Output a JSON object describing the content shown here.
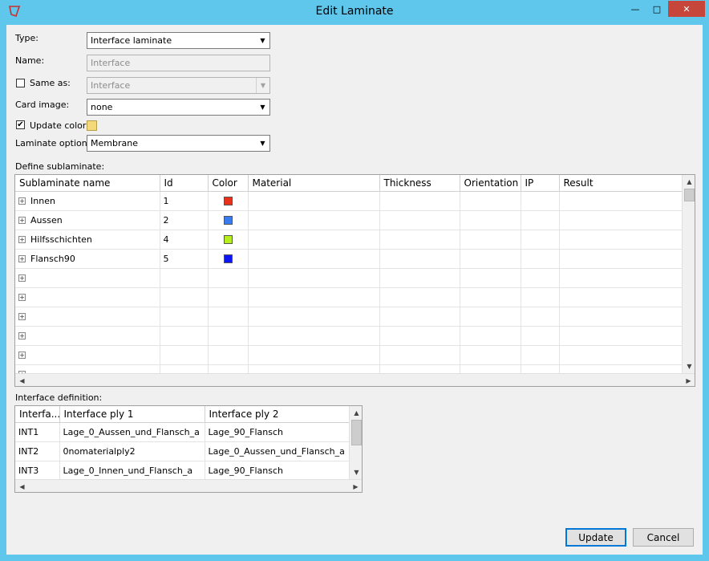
{
  "window": {
    "title": "Edit Laminate",
    "controls": {
      "minimize": "—",
      "maximize": "□",
      "close": "✕"
    }
  },
  "form": {
    "type_label": "Type:",
    "type_value": "Interface laminate",
    "name_label": "Name:",
    "name_value": "Interface",
    "same_as_label": "Same as:",
    "same_as_checked": false,
    "same_as_value": "Interface",
    "card_image_label": "Card image:",
    "card_image_value": "none",
    "update_color_label": "Update color:",
    "update_color_checked": true,
    "update_color_swatch": "#f4d97b",
    "laminate_option_label": "Laminate option:",
    "laminate_option_value": "Membrane",
    "dropdown_arrow": "▼",
    "check_mark": "✔"
  },
  "sublaminate": {
    "section_label": "Define sublaminate:",
    "columns": [
      "Sublaminate name",
      "Id",
      "Color",
      "Material",
      "Thickness",
      "Orientation",
      "IP",
      "Result"
    ],
    "expander_glyph": "+",
    "rows": [
      {
        "name": "Innen",
        "id": "1",
        "color": "#e8311c"
      },
      {
        "name": "Aussen",
        "id": "2",
        "color": "#3a7bf0"
      },
      {
        "name": "Hilfsschichten",
        "id": "4",
        "color": "#b7ef1e"
      },
      {
        "name": "Flansch90",
        "id": "5",
        "color": "#0b16f2"
      }
    ],
    "empty_rows": 6
  },
  "interface": {
    "section_label": "Interface definition:",
    "columns": [
      "Interfa...",
      "Interface ply 1",
      "Interface ply 2"
    ],
    "rows": [
      {
        "id": "INT1",
        "ply1": "Lage_0_Aussen_und_Flansch_a",
        "ply2": "Lage_90_Flansch"
      },
      {
        "id": "INT2",
        "ply1": "0nomaterialply2",
        "ply2": "Lage_0_Aussen_und_Flansch_a"
      },
      {
        "id": "INT3",
        "ply1": "Lage_0_Innen_und_Flansch_a",
        "ply2": "Lage_90_Flansch"
      }
    ]
  },
  "scroll_glyphs": {
    "up": "▲",
    "down": "▼",
    "left": "◀",
    "right": "▶"
  },
  "buttons": {
    "update": "Update",
    "cancel": "Cancel"
  }
}
